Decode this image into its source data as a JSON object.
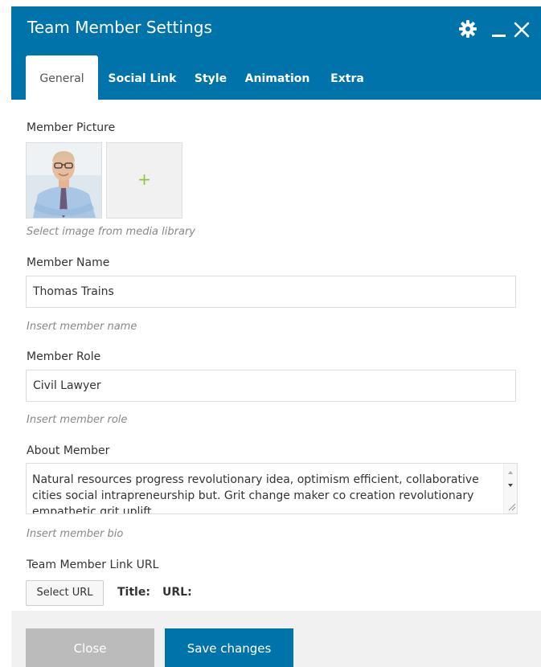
{
  "header": {
    "title": "Team Member Settings",
    "icons": [
      "gear-icon",
      "minimize-icon",
      "close-icon"
    ]
  },
  "tabs": [
    {
      "label": "General",
      "active": true
    },
    {
      "label": "Social Link",
      "active": false
    },
    {
      "label": "Style",
      "active": false
    },
    {
      "label": "Animation",
      "active": false
    },
    {
      "label": "Extra",
      "active": false
    }
  ],
  "member_picture": {
    "label": "Member Picture",
    "add_symbol": "+",
    "hint": "Select image from media library"
  },
  "member_name": {
    "label": "Member Name",
    "value": "Thomas Trains",
    "hint": "Insert member name"
  },
  "member_role": {
    "label": "Member Role",
    "value": "Civil Lawyer",
    "hint": "Insert member role"
  },
  "about_member": {
    "label": "About Member",
    "value": "Natural resources progress revolutionary idea, optimism efficient, collaborative cities social intrapreneurship but. Grit change maker co creation revolutionary empathetic grit uplift.",
    "hint": "Insert member bio"
  },
  "member_link": {
    "label": "Team Member Link URL",
    "button": "Select URL",
    "title_label": "Title:",
    "url_label": "URL:"
  },
  "footer": {
    "close_label": "Close",
    "save_label": "Save changes"
  },
  "colors": {
    "header_bg": "#0073aa",
    "save_button": "#0073aa",
    "close_button": "#bbbbbb",
    "add_plus": "#8cc63f"
  }
}
